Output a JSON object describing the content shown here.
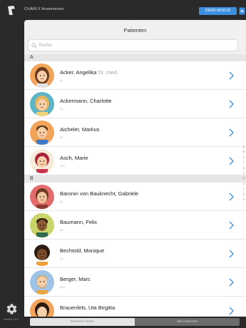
{
  "header": {
    "app_title": "CHARLY Anamnesen",
    "demo_button": "DEMO-MODUS"
  },
  "rail": {
    "bottom_text": "Version 2.0.0"
  },
  "panel": {
    "title": "Patienten",
    "search_placeholder": "Suche"
  },
  "sections": [
    {
      "letter": "A",
      "patients": [
        {
          "name": "Acker, Angelika",
          "title": "Dr. med.",
          "id": "#1",
          "avatar": "woman-brown-hair-avatar"
        },
        {
          "name": "Ackermann, Charlotte",
          "title": "",
          "id": "#2",
          "avatar": "woman-blonde-hair-avatar"
        },
        {
          "name": "Aicheler, Markus",
          "title": "",
          "id": "#3",
          "avatar": "man-brown-hair-avatar"
        },
        {
          "name": "Asch, Marie",
          "title": "",
          "id": "#23",
          "avatar": "woman-red-hair-avatar"
        }
      ]
    },
    {
      "letter": "B",
      "patients": [
        {
          "name": "Baronin von Bauknecht, Gabriele",
          "title": "",
          "id": "#1",
          "avatar": "woman-red-background-avatar"
        },
        {
          "name": "Baumann, Felix",
          "title": "",
          "id": "#3",
          "avatar": "man-dark-skin-avatar"
        },
        {
          "name": "Bechtold, Monique",
          "title": "",
          "id": "#4",
          "avatar": "woman-curly-hair-avatar"
        },
        {
          "name": "Berger, Marc",
          "title": "",
          "id": "#10",
          "avatar": "man-beard-avatar"
        },
        {
          "name": "Brauenfels, Uta Birgitta",
          "title": "",
          "id": "",
          "avatar": "woman-dark-hair-avatar"
        }
      ]
    }
  ],
  "index_letters": [
    "Q",
    "R",
    "S",
    "T",
    "U",
    "V",
    "W",
    "X",
    "Y",
    "Z",
    "#"
  ],
  "segments": {
    "recent": "Patienten heute",
    "all": "Alle Patienten"
  },
  "colors": {
    "accent": "#3d8fe0",
    "dark_chrome": "#2a2a2a",
    "panel_bg": "#f0f0f0",
    "chevron": "#3d8fe0"
  },
  "icons": {
    "logo": "charly-logo-icon",
    "exit": "exit-icon",
    "gear": "gear-icon",
    "search": "search-icon",
    "chevron": "chevron-right-icon"
  }
}
